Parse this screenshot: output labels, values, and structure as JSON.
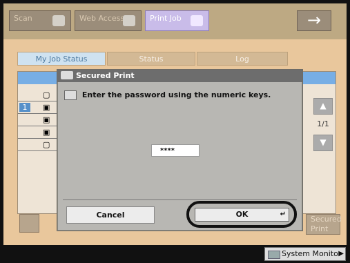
{
  "topbar": {
    "buttons": [
      {
        "label": "Scan",
        "icon": "scan-icon"
      },
      {
        "label": "Web Access",
        "icon": "web-access-icon"
      },
      {
        "label": "Print Job",
        "icon": "print-job-icon"
      }
    ],
    "arrow_label": "→"
  },
  "tabs": [
    {
      "label": "My Job Status"
    },
    {
      "label": "Status"
    },
    {
      "label": "Log"
    }
  ],
  "list": {
    "rows": [
      {
        "index": "",
        "icon": "document-icon"
      },
      {
        "index": "1",
        "icon": "lock-icon"
      },
      {
        "index": "",
        "icon": "lock-icon"
      },
      {
        "index": "",
        "icon": "lock-icon"
      },
      {
        "index": "",
        "icon": "document-icon"
      }
    ]
  },
  "page_control": {
    "page": "1/1",
    "up_icon": "▲",
    "down_icon": "▼"
  },
  "bottom": {
    "right_button_label": "Secured Print"
  },
  "dialog": {
    "title": "Secured Print",
    "message": "Enter the password using the numeric keys.",
    "password": "****",
    "cancel_label": "Cancel",
    "ok_label": "OK"
  },
  "status": {
    "system_monitor": "System Monitor"
  }
}
